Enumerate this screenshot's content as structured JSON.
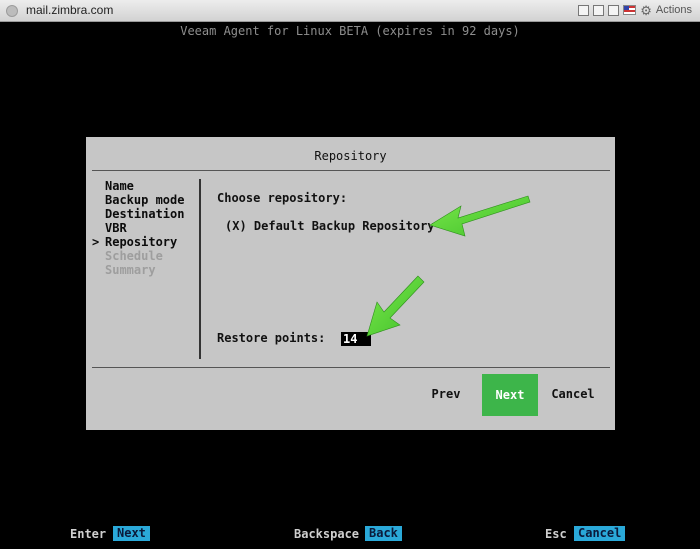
{
  "window": {
    "title": "mail.zimbra.com",
    "actions_label": "Actions"
  },
  "terminal": {
    "header": "Veeam Agent for Linux BETA (expires in 92 days)"
  },
  "dialog": {
    "title": "Repository",
    "steps": [
      {
        "label": "Name",
        "current": false,
        "future": false
      },
      {
        "label": "Backup mode",
        "current": false,
        "future": false
      },
      {
        "label": "Destination",
        "current": false,
        "future": false
      },
      {
        "label": "VBR",
        "current": false,
        "future": false
      },
      {
        "label": "Repository",
        "current": true,
        "future": false
      },
      {
        "label": "Schedule",
        "current": false,
        "future": true
      },
      {
        "label": "Summary",
        "current": false,
        "future": true
      }
    ],
    "current_marker": ">",
    "choose_label": "Choose repository:",
    "repository_option": "(X) Default Backup Repository",
    "restore_points_label": "Restore points:",
    "restore_points_value": "14",
    "buttons": {
      "prev": "Prev",
      "next": "Next",
      "cancel": "Cancel"
    }
  },
  "footer": {
    "enter_key": "Enter",
    "enter_action": "Next",
    "backspace_key": "Backspace",
    "backspace_action": "Back",
    "esc_key": "Esc",
    "esc_action": "Cancel"
  },
  "colors": {
    "dialog_bg": "#c6c6c6",
    "next_button": "#3db54a",
    "footer_action": "#2aa9d9",
    "annotation_arrow": "#5fd43a"
  }
}
